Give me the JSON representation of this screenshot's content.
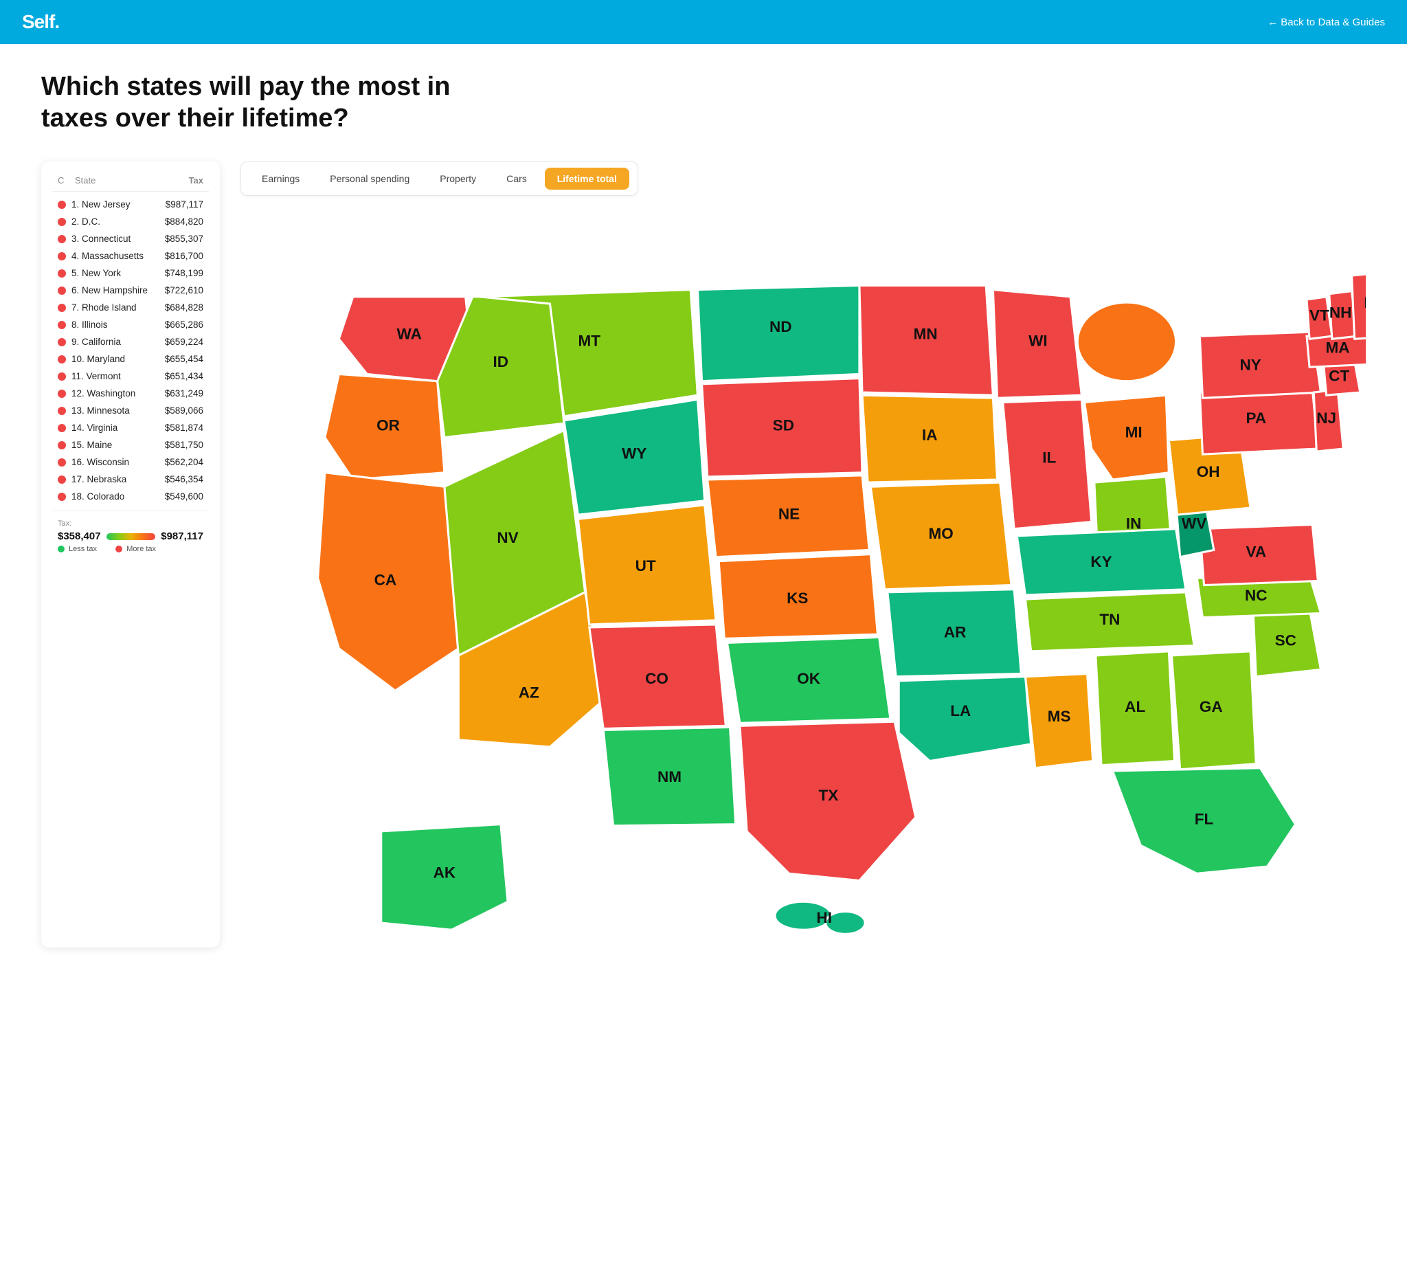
{
  "header": {
    "logo": "Self.",
    "back_link": "← Back to Data & Guides"
  },
  "page": {
    "title": "Which states will pay the most in taxes over their lifetime?"
  },
  "tabs": [
    {
      "id": "earnings",
      "label": "Earnings",
      "active": false
    },
    {
      "id": "personal_spending",
      "label": "Personal spending",
      "active": false
    },
    {
      "id": "property",
      "label": "Property",
      "active": false
    },
    {
      "id": "cars",
      "label": "Cars",
      "active": false
    },
    {
      "id": "lifetime_total",
      "label": "Lifetime total",
      "active": true
    }
  ],
  "table": {
    "col_c": "C",
    "col_state": "State",
    "col_tax": "Tax",
    "rows": [
      {
        "rank": "1.",
        "name": "New Jersey",
        "tax": "$987,117",
        "color": "#ef4444"
      },
      {
        "rank": "2.",
        "name": "D.C.",
        "tax": "$884,820",
        "color": "#ef4444"
      },
      {
        "rank": "3.",
        "name": "Connecticut",
        "tax": "$855,307",
        "color": "#ef4444"
      },
      {
        "rank": "4.",
        "name": "Massachusetts",
        "tax": "$816,700",
        "color": "#ef4444"
      },
      {
        "rank": "5.",
        "name": "New York",
        "tax": "$748,199",
        "color": "#ef4444"
      },
      {
        "rank": "6.",
        "name": "New Hampshire",
        "tax": "$722,610",
        "color": "#ef4444"
      },
      {
        "rank": "7.",
        "name": "Rhode Island",
        "tax": "$684,828",
        "color": "#ef4444"
      },
      {
        "rank": "8.",
        "name": "Illinois",
        "tax": "$665,286",
        "color": "#ef4444"
      },
      {
        "rank": "9.",
        "name": "California",
        "tax": "$659,224",
        "color": "#ef4444"
      },
      {
        "rank": "10.",
        "name": "Maryland",
        "tax": "$655,454",
        "color": "#ef4444"
      },
      {
        "rank": "11.",
        "name": "Vermont",
        "tax": "$651,434",
        "color": "#ef4444"
      },
      {
        "rank": "12.",
        "name": "Washington",
        "tax": "$631,249",
        "color": "#ef4444"
      },
      {
        "rank": "13.",
        "name": "Minnesota",
        "tax": "$589,066",
        "color": "#ef4444"
      },
      {
        "rank": "14.",
        "name": "Virginia",
        "tax": "$581,874",
        "color": "#ef4444"
      },
      {
        "rank": "15.",
        "name": "Maine",
        "tax": "$581,750",
        "color": "#ef4444"
      },
      {
        "rank": "16.",
        "name": "Wisconsin",
        "tax": "$562,204",
        "color": "#ef4444"
      },
      {
        "rank": "17.",
        "name": "Nebraska",
        "tax": "$546,354",
        "color": "#ef4444"
      },
      {
        "rank": "18.",
        "name": "Colorado",
        "tax": "$549,600",
        "color": "#ef4444"
      }
    ]
  },
  "legend": {
    "label": "Tax:",
    "min": "$358,407",
    "max": "$987,117",
    "less_tax": "Less tax",
    "more_tax": "More tax"
  }
}
